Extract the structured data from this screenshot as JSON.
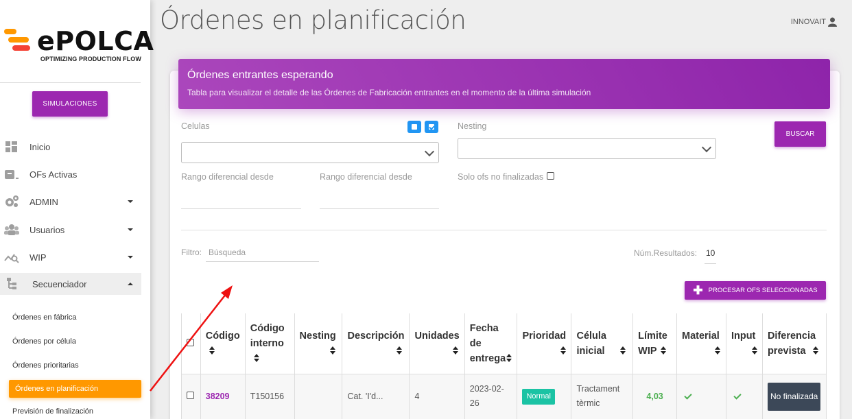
{
  "brand": {
    "name": "ePOLCA",
    "tagline": "OPTIMIZING PRODUCTION FLOW",
    "colors": [
      "#ff9800",
      "#f44336"
    ]
  },
  "sidebar": {
    "simulations_button": "SIMULACIONES",
    "items": [
      {
        "label": "Inicio",
        "icon": "dashboard-icon"
      },
      {
        "label": "OFs Activas",
        "icon": "inbox-icon"
      },
      {
        "label": "ADMIN",
        "icon": "gears-icon",
        "expandable": true
      },
      {
        "label": "Usuarios",
        "icon": "users-icon",
        "expandable": true
      },
      {
        "label": "WIP",
        "icon": "chart-search-icon",
        "expandable": true
      },
      {
        "label": "Secuenciador",
        "icon": "sitemap-icon",
        "expandable": true,
        "open": true
      }
    ],
    "subitems": [
      {
        "label": "Órdenes en fábrica"
      },
      {
        "label": "Órdenes por célula"
      },
      {
        "label": "Órdenes prioritarias"
      },
      {
        "label": "Órdenes en planificación",
        "active": true
      },
      {
        "label": "Previsión de finalización"
      }
    ]
  },
  "header": {
    "title": "Órdenes en planificación",
    "user": "INNOVAIT"
  },
  "card": {
    "title": "Órdenes entrantes esperando",
    "subtitle": "Tabla para visualizar el detalle de las Órdenes de Fabricación entrantes en el momento de la última simulación"
  },
  "filters": {
    "celulas_label": "Celulas",
    "nesting_label": "Nesting",
    "search_button": "BUSCAR",
    "rango_desde_label": "Rango diferencial desde",
    "rango_hasta_label": "Rango diferencial desde",
    "solo_no_finalizadas_label": "Solo ofs no finalizadas",
    "filtro_label": "Filtro:",
    "busqueda_placeholder": "Búsqueda",
    "num_resultados_label": "Núm.Resultados:",
    "num_resultados_value": "10",
    "process_button": "PROCESAR OFS SELECCIONADAS"
  },
  "table": {
    "columns": [
      [
        "Código"
      ],
      [
        "Código",
        "interno"
      ],
      [
        "Nesting"
      ],
      [
        "Descripción"
      ],
      [
        "Unidades"
      ],
      [
        "Fecha",
        "de",
        "entrega"
      ],
      [
        "Prioridad"
      ],
      [
        "Célula",
        "inicial"
      ],
      [
        "Límite",
        "WIP"
      ],
      [
        "Material"
      ],
      [
        "Input"
      ],
      [
        "Diferencia",
        "prevista"
      ]
    ],
    "rows": [
      {
        "codigo": "38209",
        "codigo_interno": "T150156",
        "nesting": "",
        "descripcion": "Cat. 'I'd...",
        "unidades": "4",
        "fecha_entrega": [
          "2023-02-",
          "26"
        ],
        "prioridad": "Normal",
        "celula_inicial": [
          "Tractament",
          "tèrmic"
        ],
        "limite_wip": "4,03",
        "diferencia_prevista": "No finalizada"
      }
    ]
  }
}
